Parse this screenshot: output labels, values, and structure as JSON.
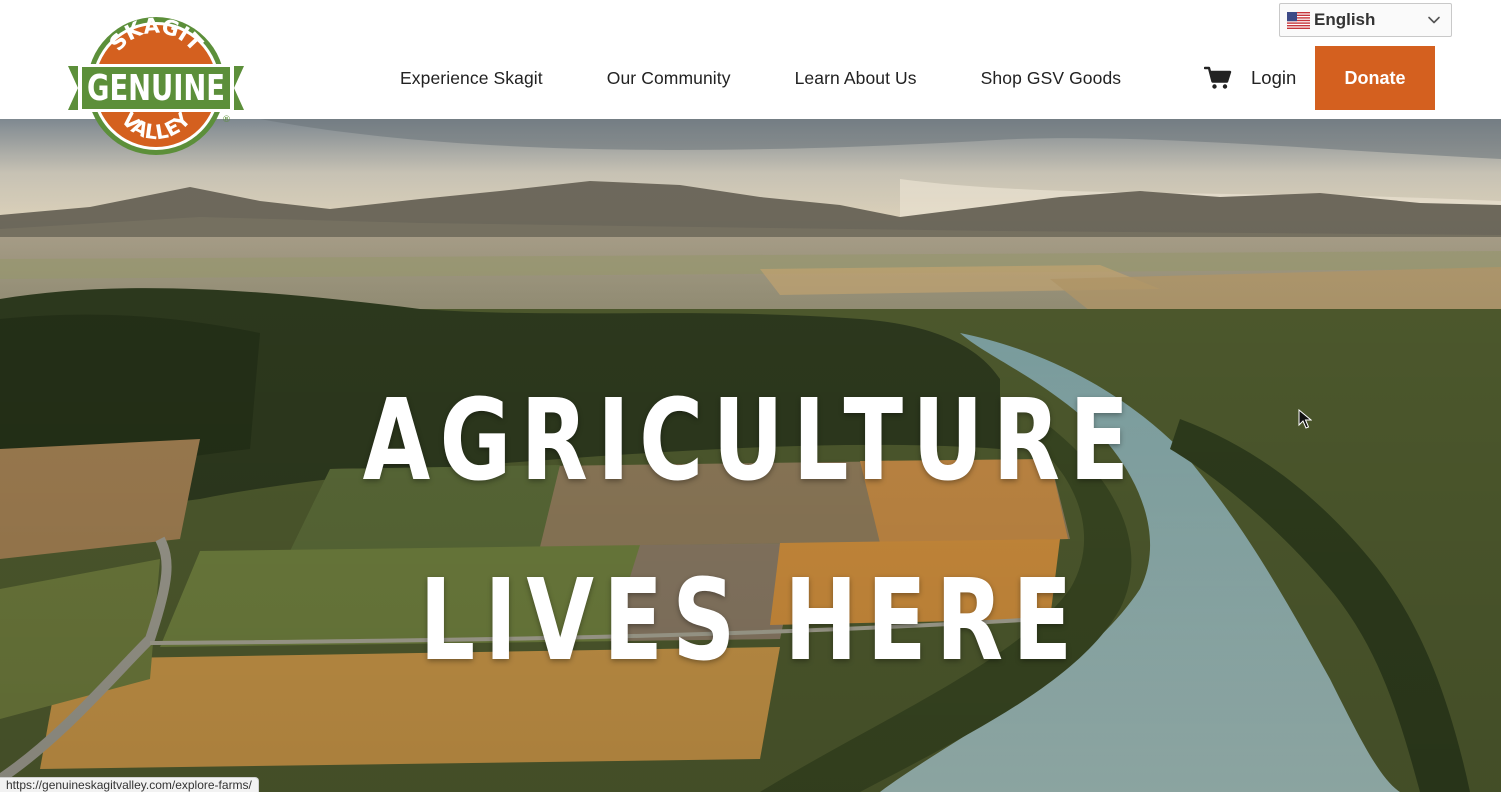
{
  "language_selector": {
    "label": "English",
    "flag_icon": "us-flag-icon"
  },
  "logo": {
    "top_text": "SKAGIT",
    "middle_text": "GENUINE",
    "bottom_text": "VALLEY",
    "mark": "®"
  },
  "nav": {
    "items": [
      {
        "label": "Experience Skagit"
      },
      {
        "label": "Our Community"
      },
      {
        "label": "Learn About Us"
      },
      {
        "label": "Shop GSV Goods"
      }
    ]
  },
  "cart": {
    "icon": "shopping-cart-icon"
  },
  "login_label": "Login",
  "donate_label": "Donate",
  "hero": {
    "headline_line1": "AGRICULTURE",
    "headline_line2": "LIVES HERE"
  },
  "status_bar": {
    "url": "https://genuineskagitvalley.com/explore-farms/"
  },
  "colors": {
    "brand_orange": "#d4601f",
    "brand_green": "#5c8f3a",
    "nav_text": "#222222",
    "white": "#ffffff"
  }
}
